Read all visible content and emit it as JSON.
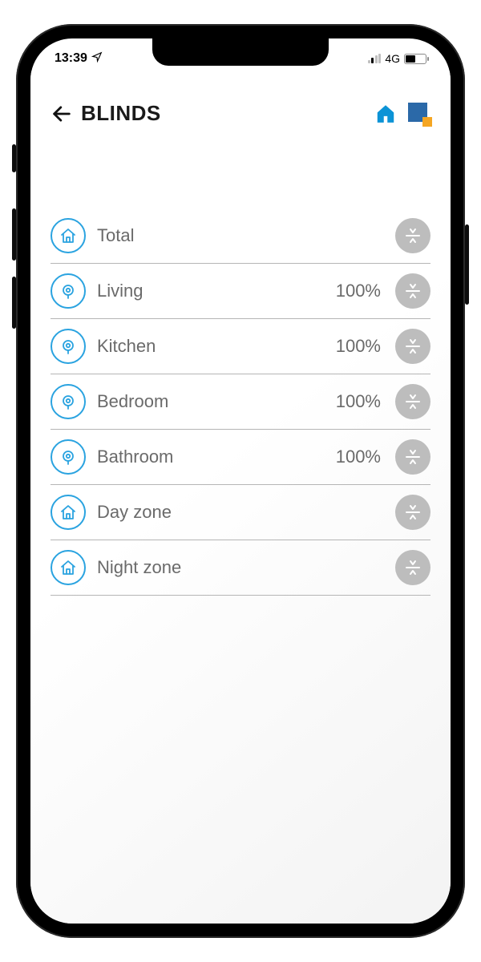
{
  "status": {
    "time": "13:39",
    "network_label": "4G"
  },
  "header": {
    "title": "BLINDS"
  },
  "list": {
    "items": [
      {
        "icon": "home",
        "label": "Total",
        "value": ""
      },
      {
        "icon": "blind",
        "label": "Living",
        "value": "100%"
      },
      {
        "icon": "blind",
        "label": "Kitchen",
        "value": "100%"
      },
      {
        "icon": "blind",
        "label": "Bedroom",
        "value": "100%"
      },
      {
        "icon": "blind",
        "label": "Bathroom",
        "value": "100%"
      },
      {
        "icon": "home",
        "label": "Day zone",
        "value": ""
      },
      {
        "icon": "home",
        "label": "Night zone",
        "value": ""
      }
    ]
  },
  "colors": {
    "accent": "#2aa3e0",
    "brand_blue": "#2b69a8",
    "brand_orange": "#f5a623",
    "action_bg": "#bdbdbd",
    "text_muted": "#6a6a6a"
  }
}
